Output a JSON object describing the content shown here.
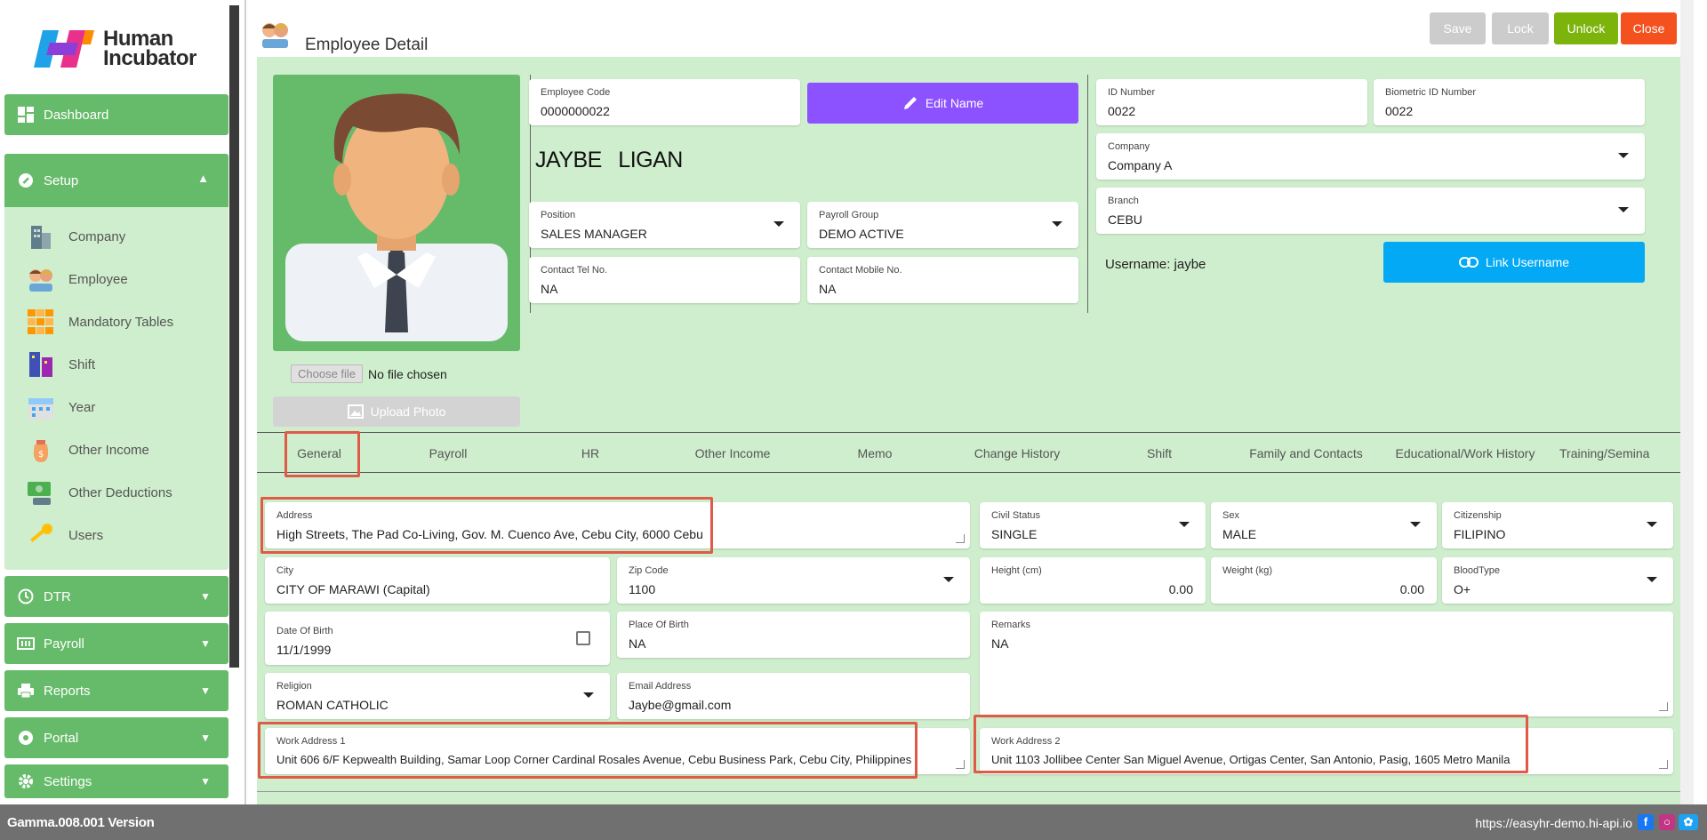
{
  "app": {
    "logo_line1": "Human",
    "logo_line2": "Incubator",
    "version": "Gamma.008.001 Version",
    "site_url": "https://easyhr-demo.hi-api.io"
  },
  "sidebar": {
    "dashboard": "Dashboard",
    "setup": "Setup",
    "setup_items": [
      "Company",
      "Employee",
      "Mandatory Tables",
      "Shift",
      "Year",
      "Other Income",
      "Other Deductions",
      "Users"
    ],
    "dtr": "DTR",
    "payroll": "Payroll",
    "reports": "Reports",
    "portal": "Portal",
    "settings": "Settings"
  },
  "header": {
    "title": "Employee Detail",
    "buttons": {
      "save": "Save",
      "lock": "Lock",
      "unlock": "Unlock",
      "close": "Close"
    }
  },
  "colors": {
    "primary": "#66bb6a",
    "content_bg": "#cfeecd",
    "unlock": "#7cb40c",
    "close": "#f4511e",
    "edit_name": "#8c52ff",
    "link_username": "#03a9f4",
    "highlight": "#e05a48",
    "disabled": "#cccccc"
  },
  "photo": {
    "choose_file": "Choose file",
    "no_file": "No file chosen",
    "upload": "Upload Photo"
  },
  "employee": {
    "code_label": "Employee Code",
    "code": "0000000022",
    "edit_name": "Edit Name",
    "first_name": "JAYBE",
    "last_name": "LIGAN",
    "position_label": "Position",
    "position": "SALES MANAGER",
    "payroll_group_label": "Payroll Group",
    "payroll_group": "DEMO ACTIVE",
    "contact_tel_label": "Contact Tel No.",
    "contact_tel": "NA",
    "contact_mobile_label": "Contact Mobile No.",
    "contact_mobile": "NA",
    "id_label": "ID Number",
    "id": "0022",
    "biometric_label": "Biometric ID Number",
    "biometric": "0022",
    "company_label": "Company",
    "company": "Company A",
    "branch_label": "Branch",
    "branch": "CEBU",
    "username_text": "Username: jaybe",
    "link_username": "Link Username"
  },
  "tabs": [
    "General",
    "Payroll",
    "HR",
    "Other Income",
    "Memo",
    "Change History",
    "Shift",
    "Family and Contacts",
    "Educational/Work History",
    "Training/Semina"
  ],
  "general": {
    "address_label": "Address",
    "address": "High Streets, The Pad Co-Living, Gov. M. Cuenco Ave, Cebu City, 6000 Cebu",
    "civil_status_label": "Civil Status",
    "civil_status": "SINGLE",
    "sex_label": "Sex",
    "sex": "MALE",
    "citizenship_label": "Citizenship",
    "citizenship": "FILIPINO",
    "city_label": "City",
    "city": "CITY OF MARAWI (Capital)",
    "zip_label": "Zip Code",
    "zip": "1100",
    "height_label": "Height (cm)",
    "height": "0.00",
    "weight_label": "Weight (kg)",
    "weight": "0.00",
    "bloodtype_label": "BloodType",
    "bloodtype": "O+",
    "dob_label": "Date Of Birth",
    "dob": "11/1/1999",
    "pob_label": "Place Of Birth",
    "pob": "NA",
    "remarks_label": "Remarks",
    "remarks": "NA",
    "religion_label": "Religion",
    "religion": "ROMAN CATHOLIC",
    "email_label": "Email Address",
    "email": "Jaybe@gmail.com",
    "work1_label": "Work Address 1",
    "work1": "Unit 606 6/F Kepwealth Building, Samar Loop Corner Cardinal Rosales Avenue, Cebu Business Park, Cebu City, Philippines",
    "work2_label": "Work Address 2",
    "work2": "Unit 1103 Jollibee Center San Miguel Avenue, Ortigas Center, San Antonio, Pasig, 1605 Metro Manila"
  }
}
